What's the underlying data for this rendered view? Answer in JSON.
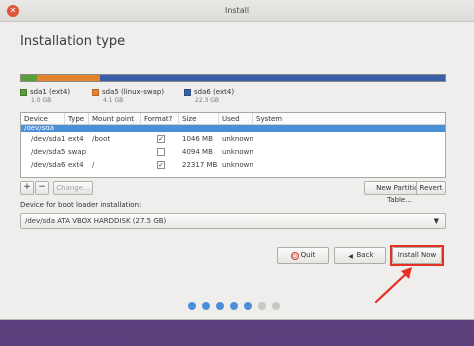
{
  "window": {
    "title": "Install"
  },
  "heading": "Installation type",
  "disk_bar": {
    "segments": [
      {
        "name": "sda1 (ext4)",
        "size": "1.0 GB",
        "fraction": 0.038,
        "color": "#5a9d3b"
      },
      {
        "name": "sda5 (linux-swap)",
        "size": "4.1 GB",
        "fraction": 0.149,
        "color": "#e3832b"
      },
      {
        "name": "sda6 (ext4)",
        "size": "22.3 GB",
        "fraction": 0.813,
        "color": "#3b5ea8"
      }
    ]
  },
  "table": {
    "headers": [
      "Device",
      "Type",
      "Mount point",
      "Format?",
      "Size",
      "Used",
      "System"
    ],
    "selected_row": "/dev/sda",
    "rows": [
      {
        "device": "/dev/sda1",
        "type": "ext4",
        "mount": "/boot",
        "format": true,
        "size": "1046 MB",
        "used": "unknown"
      },
      {
        "device": "/dev/sda5",
        "type": "swap",
        "mount": "",
        "format": false,
        "size": "4094 MB",
        "used": "unknown"
      },
      {
        "device": "/dev/sda6",
        "type": "ext4",
        "mount": "/",
        "format": true,
        "size": "22317 MB",
        "used": "unknown"
      }
    ]
  },
  "toolbar": {
    "add_label": "+",
    "remove_label": "−",
    "change_label": "Change...",
    "new_table_label": "New Partition Table...",
    "revert_label": "Revert"
  },
  "boot_loader": {
    "label": "Device for boot loader installation:",
    "selected": "/dev/sda   ATA VBOX HARDDISK (27.5 GB)"
  },
  "nav": {
    "quit_label": "Quit",
    "back_label": "Back",
    "install_label": "Install Now"
  },
  "progress_dots": {
    "total": 7,
    "filled": 5
  },
  "colors": {
    "accent": "#4a90d9",
    "highlight": "#e53124"
  }
}
